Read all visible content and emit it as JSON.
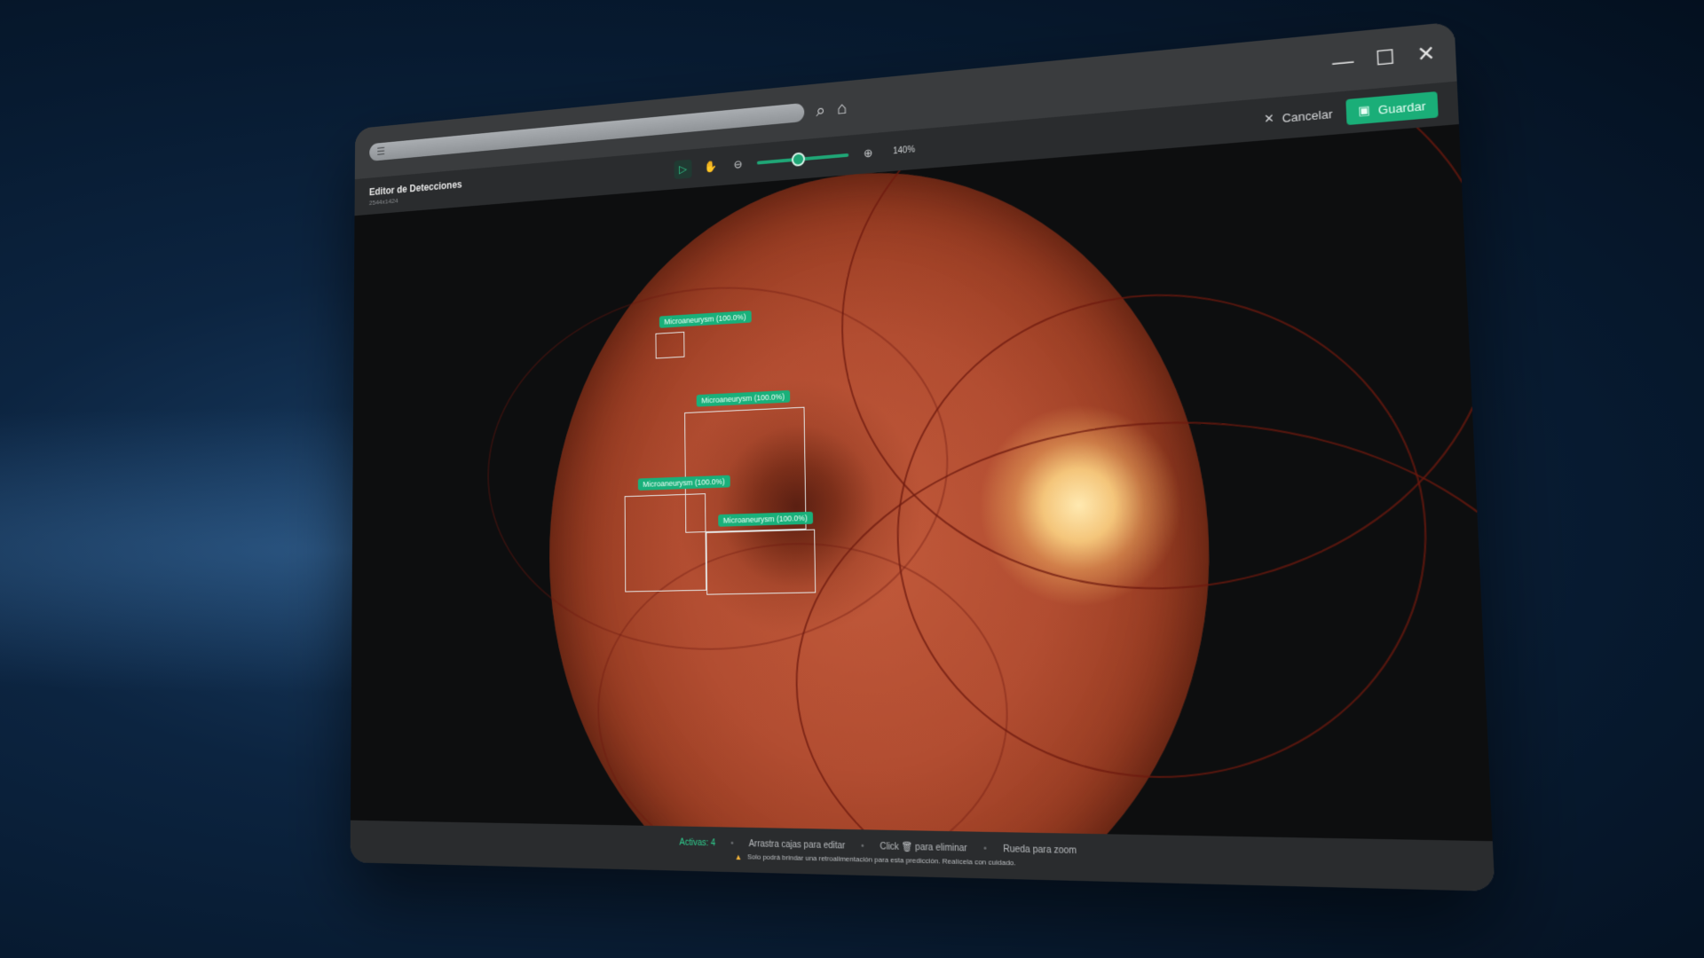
{
  "window": {
    "title": "Editor de Detecciones",
    "subtitle": "2544x1424",
    "zoom": "140%",
    "zoom_fraction": 0.45
  },
  "toolbar": {
    "cancel_label": "Cancelar",
    "save_label": "Guardar"
  },
  "detections": [
    {
      "label": "Microaneurysm (100.0%)"
    },
    {
      "label": "Microaneurysm (100.0%)"
    },
    {
      "label": "Microaneurysm (100.0%)"
    },
    {
      "label": "Microaneurysm (100.0%)"
    }
  ],
  "status": {
    "active": "Activas: 4",
    "hint_drag": "Arrastra cajas para editar",
    "hint_click": "Click 🗑 para eliminar",
    "hint_wheel": "Rueda para zoom",
    "warning": "Solo podrá brindar una retroalimentación para esta predicción. Realícela con cuidado."
  },
  "colors": {
    "accent": "#1aae78",
    "label_bg": "#19b07a"
  }
}
